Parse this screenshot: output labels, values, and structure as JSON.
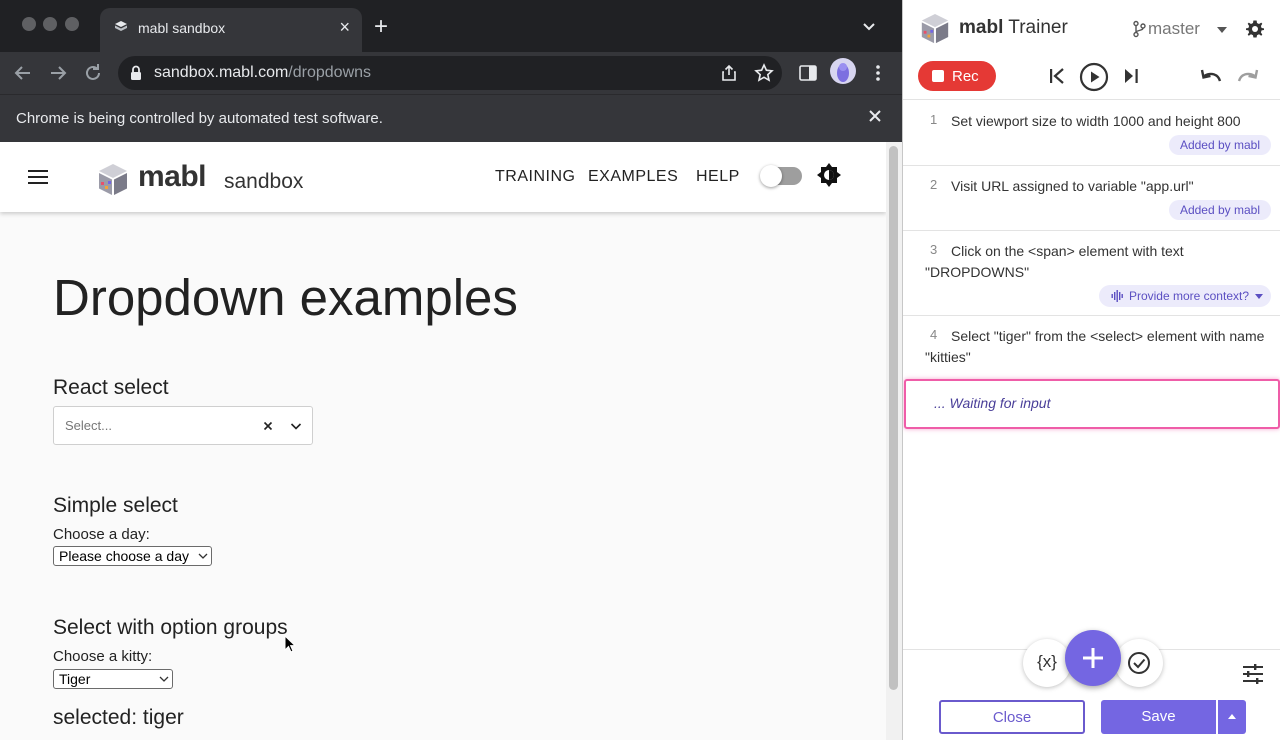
{
  "browser": {
    "tab_title": "mabl sandbox",
    "url_host": "sandbox.mabl.com",
    "url_path": "/dropdowns",
    "infobar_message": "Chrome is being controlled by automated test software."
  },
  "site": {
    "brand": "mabl",
    "brand_sub": "sandbox",
    "nav": [
      "TRAINING",
      "EXAMPLES",
      "HELP"
    ]
  },
  "page": {
    "title": "Dropdown examples",
    "react_select": {
      "heading": "React select",
      "placeholder": "Select..."
    },
    "simple_select": {
      "heading": "Simple select",
      "label": "Choose a day:",
      "value": "Please choose a day"
    },
    "group_select": {
      "heading": "Select with option groups",
      "label": "Choose a kitty:",
      "value": "Tiger"
    },
    "selected_text": "selected: tiger"
  },
  "trainer": {
    "title_bold": "mabl",
    "title_rest": "Trainer",
    "branch": "master",
    "rec_label": "Rec",
    "steps": [
      {
        "num": "1",
        "text": "Set viewport size to width 1000 and height 800",
        "badge": "Added by mabl"
      },
      {
        "num": "2",
        "text": "Visit URL assigned to variable \"app.url\"",
        "badge": "Added by mabl"
      },
      {
        "num": "3",
        "text": "Click on the <span> element with text \"DROPDOWNS\"",
        "badge": "Provide more context?"
      },
      {
        "num": "4",
        "text": "Select \"tiger\" from the <select> element with name \"kitties\""
      }
    ],
    "waiting_text": "... Waiting for input",
    "var_button": "{x}",
    "close_label": "Close",
    "save_label": "Save"
  },
  "colors": {
    "accent": "#7466e2",
    "record_red": "#e53935",
    "waiting_border": "#ef5da8"
  }
}
